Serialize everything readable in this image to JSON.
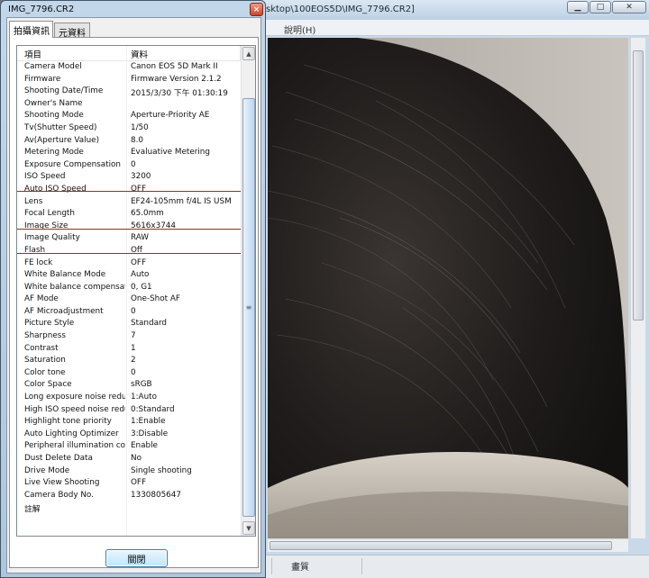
{
  "dialog": {
    "title": "IMG_7796.CR2",
    "close_glyph": "×",
    "tabs": [
      {
        "label": "拍攝資訊"
      },
      {
        "label": "元資料"
      }
    ],
    "columns": {
      "item": "項目",
      "data": "資料"
    },
    "rows": [
      {
        "item": "Camera Model",
        "value": "Canon EOS 5D Mark II"
      },
      {
        "item": "Firmware",
        "value": "Firmware Version 2.1.2"
      },
      {
        "item": "Shooting Date/Time",
        "value": "2015/3/30 下午 01:30:19"
      },
      {
        "item": "Owner's Name",
        "value": ""
      },
      {
        "item": "Shooting Mode",
        "value": "Aperture-Priority AE"
      },
      {
        "item": "Tv(Shutter Speed)",
        "value": "1/50"
      },
      {
        "item": "Av(Aperture Value)",
        "value": "8.0"
      },
      {
        "item": "Metering Mode",
        "value": "Evaluative Metering"
      },
      {
        "item": "Exposure Compensation",
        "value": "0"
      },
      {
        "item": "ISO Speed",
        "value": "3200"
      },
      {
        "item": "Auto ISO Speed",
        "value": "OFF"
      },
      {
        "item": "Lens",
        "value": "EF24-105mm f/4L IS USM"
      },
      {
        "item": "Focal Length",
        "value": "65.0mm"
      },
      {
        "item": "Image Size",
        "value": "5616x3744"
      },
      {
        "item": "Image Quality",
        "value": "RAW"
      },
      {
        "item": "Flash",
        "value": "Off"
      },
      {
        "item": "FE lock",
        "value": "OFF"
      },
      {
        "item": "White Balance Mode",
        "value": "Auto"
      },
      {
        "item": "White balance compensation",
        "value": "0, G1"
      },
      {
        "item": "AF Mode",
        "value": "One-Shot AF"
      },
      {
        "item": "AF Microadjustment",
        "value": "0"
      },
      {
        "item": "Picture Style",
        "value": "Standard"
      },
      {
        "item": "Sharpness",
        "value": "7"
      },
      {
        "item": "Contrast",
        "value": "1"
      },
      {
        "item": "Saturation",
        "value": "2"
      },
      {
        "item": "Color tone",
        "value": "0"
      },
      {
        "item": "Color Space",
        "value": "sRGB"
      },
      {
        "item": "Long exposure noise reducti...",
        "value": "1:Auto"
      },
      {
        "item": "High ISO speed noise reduc...",
        "value": "0:Standard"
      },
      {
        "item": "Highlight tone priority",
        "value": "1:Enable"
      },
      {
        "item": "Auto Lighting Optimizer",
        "value": "3:Disable"
      },
      {
        "item": "Peripheral illumination corre...",
        "value": "Enable"
      },
      {
        "item": "Dust Delete Data",
        "value": "No"
      },
      {
        "item": "Drive Mode",
        "value": "Single shooting"
      },
      {
        "item": "Live View Shooting",
        "value": "OFF"
      },
      {
        "item": "Camera Body No.",
        "value": "1330805647"
      },
      {
        "item": "註解",
        "value": ""
      }
    ],
    "scroll_up_glyph": "▲",
    "scroll_down_glyph": "▼",
    "scroll_grip_glyph": "≡",
    "close_button": "關閉"
  },
  "viewer": {
    "title": "sktop\\100EOS5D\\IMG_7796.CR2]",
    "menu_help": "說明(H)",
    "status_label": "畫質",
    "window_controls": {
      "minimize": "▁",
      "maximize": "□",
      "close": "✕"
    }
  },
  "icons": [
    "close-icon",
    "minimize-icon",
    "maximize-icon",
    "scroll-up-icon",
    "scroll-down-icon",
    "scroll-grip-icon"
  ]
}
